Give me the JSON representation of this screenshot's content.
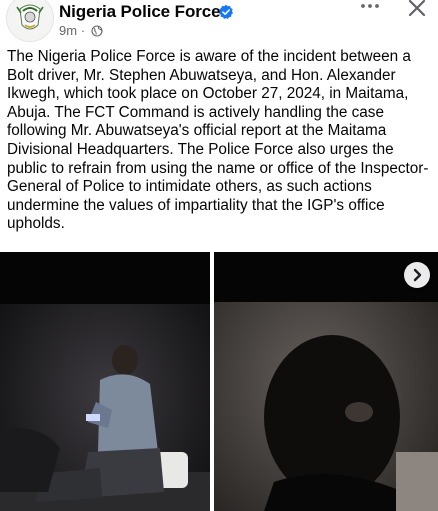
{
  "header": {
    "page_name": "Nigeria Police Force",
    "timestamp": "9m",
    "separator": "·",
    "verified": true,
    "icons": [
      "police-crest-avatar",
      "verified-badge-icon",
      "globe-icon",
      "more-options-icon",
      "close-icon"
    ]
  },
  "post": {
    "body": "The Nigeria Police Force is aware of the incident between a Bolt driver, Mr. Stephen Abuwatseya, and Hon. Alexander Ikwegh, which took place on October 27, 2024, in Maitama, Abuja. The FCT Command is actively handling the case following Mr. Abuwatseya's official report at the Maitama Divisional Headquarters. The Police Force also urges the public to refrain from using the name or office of the Inspector-General of Police to intimidate others, as such actions undermine the values of impartiality that the IGP's office upholds."
  },
  "media": {
    "items": [
      {
        "kind": "video",
        "description_icon": "play-icon"
      },
      {
        "kind": "video",
        "description_icon": "play-icon"
      }
    ],
    "next_icon": "chevron-right-icon"
  },
  "colors": {
    "verified_blue": "#1877f2",
    "meta_gray": "#65676b",
    "text": "#050505"
  }
}
